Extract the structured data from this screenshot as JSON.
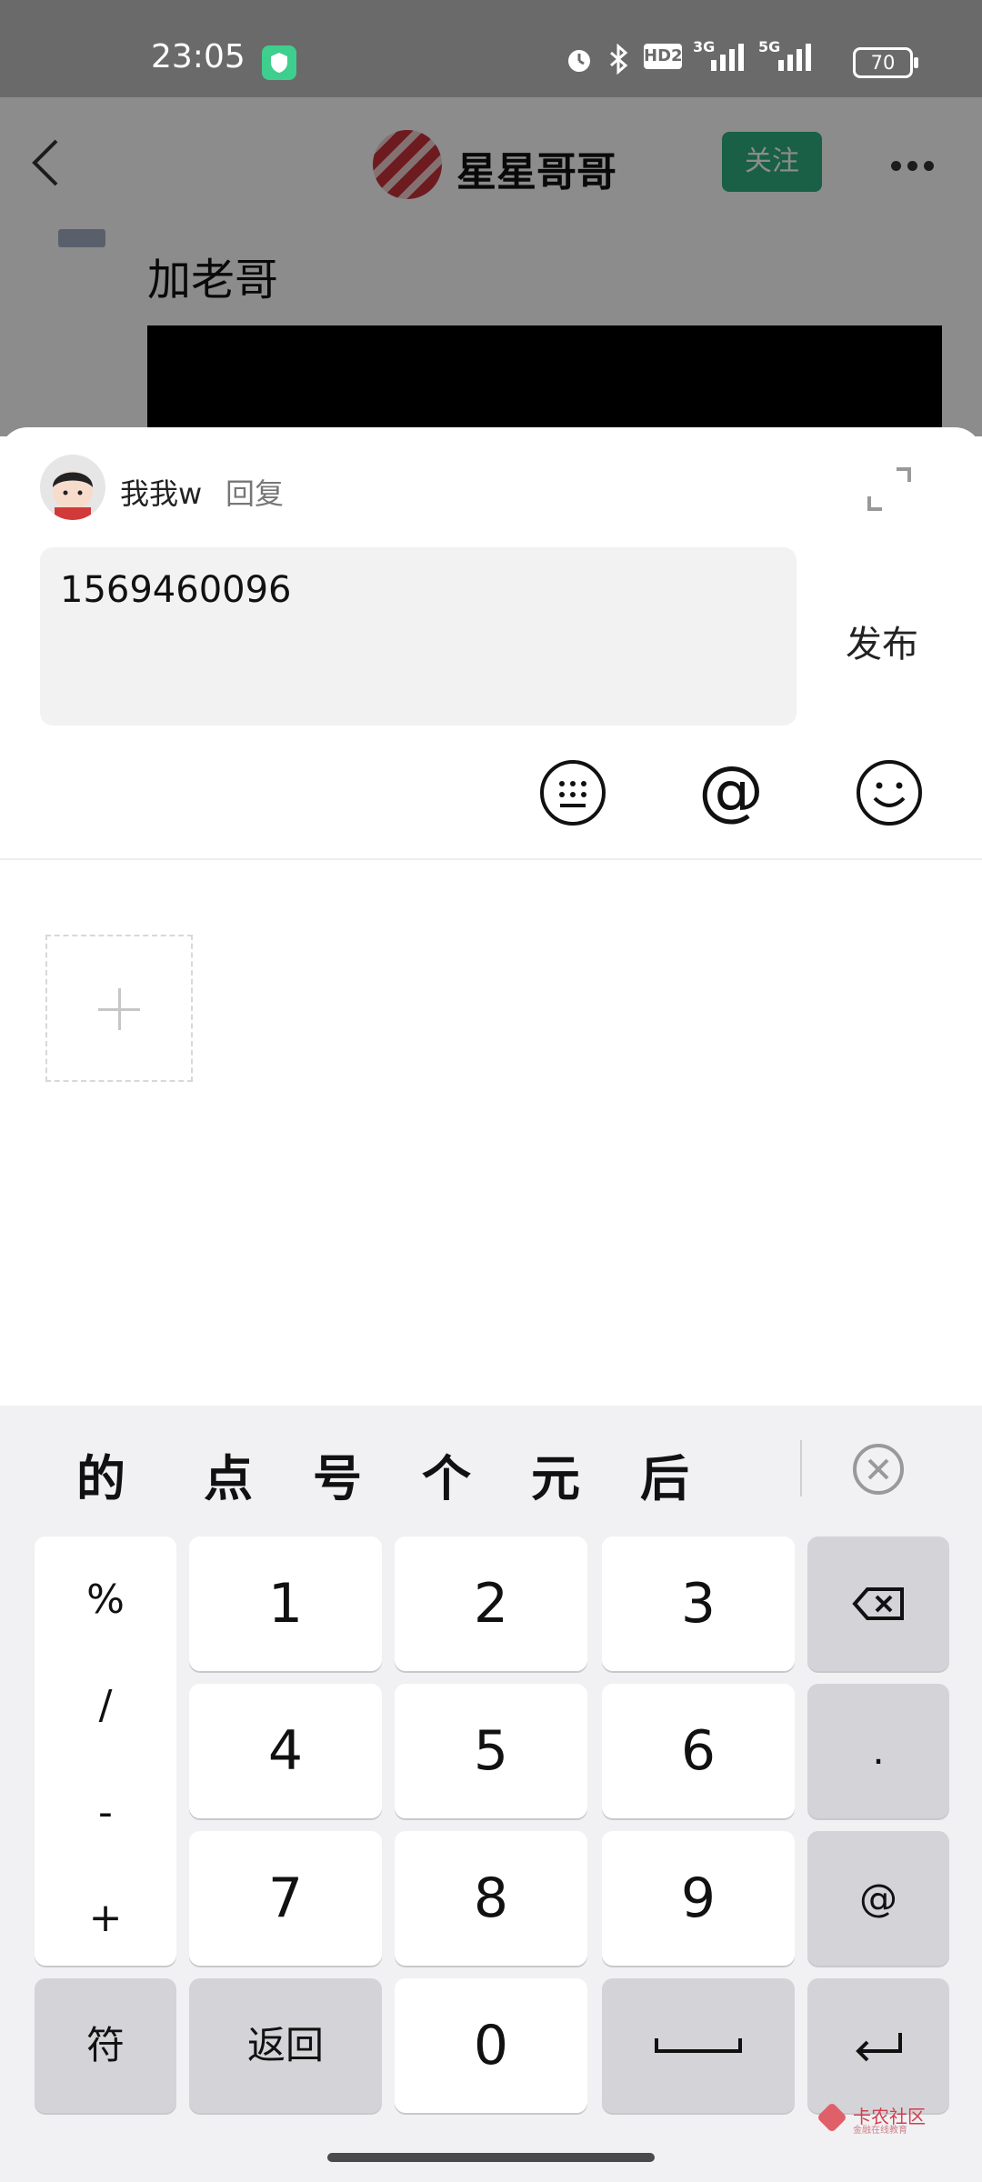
{
  "status_bar": {
    "time": "23:05",
    "battery": "70",
    "icons": [
      "shield-app-icon",
      "alarm-icon",
      "bluetooth-icon",
      "hd-icon",
      "signal-3g-icon",
      "signal-5g-icon",
      "battery-icon"
    ],
    "hd_label": "HD2",
    "net1": "3G",
    "net2": "5G"
  },
  "post_header": {
    "author_name": "星星哥哥",
    "follow_label": "关注",
    "post_text": "加老哥"
  },
  "reply_sheet": {
    "user_name": "我我w",
    "verb": "回复",
    "input_value": "1569460096",
    "publish_label": "发布",
    "tools": [
      "keyboard-icon",
      "at-icon",
      "emoji-icon"
    ]
  },
  "keyboard": {
    "candidates": [
      "的",
      "点",
      "号",
      "个",
      "元",
      "后"
    ],
    "symbols": [
      "%",
      "/",
      "-",
      "+"
    ],
    "digits": [
      "1",
      "2",
      "3",
      "4",
      "5",
      "6",
      "7",
      "8",
      "9",
      "0"
    ],
    "right_keys": [
      ".",
      "@"
    ],
    "bottom": {
      "symbols_label": "符",
      "back_label": "返回"
    }
  },
  "watermark": {
    "text": "卡农社区",
    "sub": "金融在线教育"
  },
  "colors": {
    "accent": "#2fb080",
    "keyboard_bg": "#f1f1f3"
  }
}
